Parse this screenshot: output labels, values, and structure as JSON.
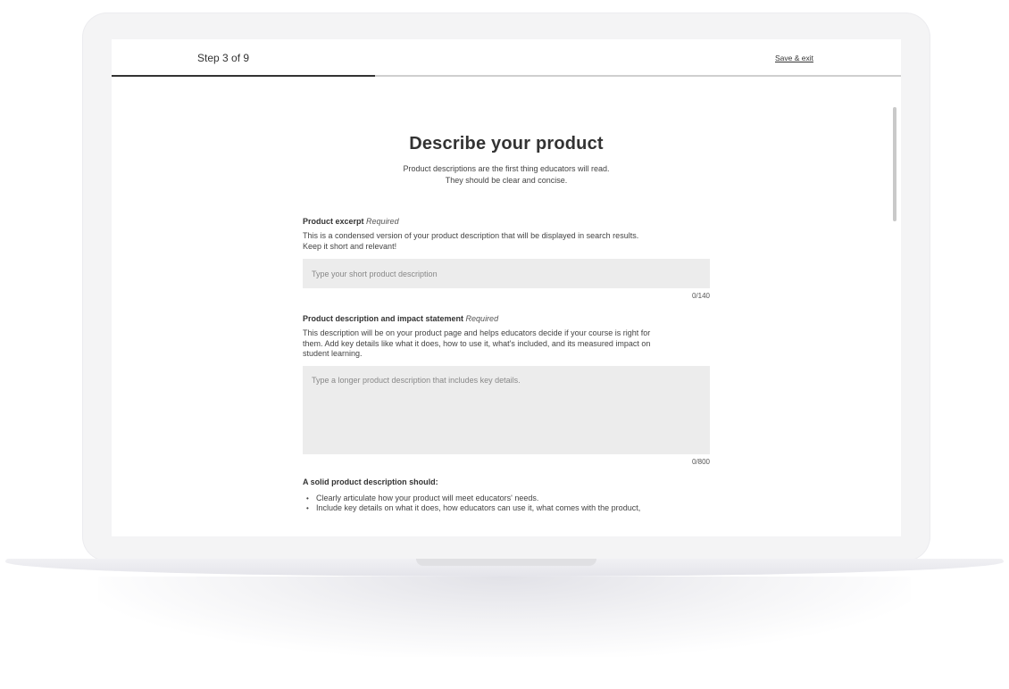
{
  "header": {
    "step_label": "Step 3 of 9",
    "save_exit_label": "Save & exit",
    "progress": {
      "current": 3,
      "total": 9
    }
  },
  "main": {
    "title": "Describe your product",
    "subtitle_line1": "Product descriptions are the first thing educators will read.",
    "subtitle_line2": "They should be clear and concise.",
    "excerpt": {
      "label": "Product excerpt",
      "required_label": "Required",
      "help_line1": "This is a condensed version of your product description that will be displayed in search results.",
      "help_line2": "Keep it short and relevant!",
      "value": "",
      "placeholder": "Type your short product description",
      "counter": "0/140"
    },
    "description": {
      "label": "Product description and impact statement",
      "required_label": "Required",
      "help_line1": "This description will be on your product page and helps educators decide if your course is right for",
      "help_line2": "them. Add key details like what it does, how to use it, what's included, and its measured impact on",
      "help_line3": "student learning.",
      "value": "",
      "placeholder": "Type a longer product description that includes key details.",
      "counter": "0/800"
    },
    "guide": {
      "title": "A solid product description should:",
      "items": [
        "Clearly articulate how your product will meet educators' needs.",
        "Include key details on what it does, how educators can use it, what comes with the product,"
      ]
    }
  },
  "colors": {
    "progress_fill": "#333333",
    "progress_track": "#cfcfcf",
    "input_background": "#ececec",
    "text_primary": "#333333"
  }
}
